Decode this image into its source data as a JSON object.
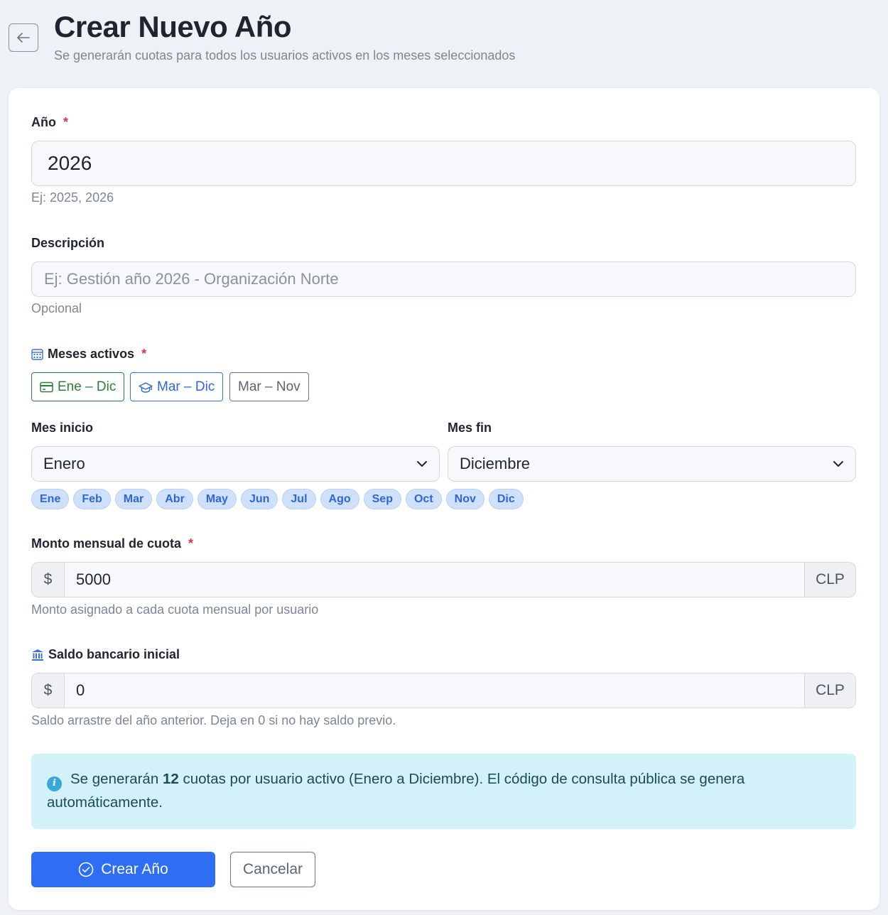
{
  "header": {
    "back_icon": "arrow-left-icon",
    "title": "Crear Nuevo Año",
    "subtitle": "Se generarán cuotas para todos los usuarios activos en los meses seleccionados"
  },
  "form": {
    "year": {
      "label": "Año",
      "required": "*",
      "value": "2026",
      "hint": "Ej: 2025, 2026"
    },
    "description": {
      "label": "Descripción",
      "placeholder": "Ej: Gestión año 2026 - Organización Norte",
      "value": "",
      "hint": "Opcional"
    },
    "months": {
      "label": "Meses activos",
      "required": "*",
      "icon": "calendar-icon",
      "presets": [
        {
          "label": "Ene – Dic",
          "icon": "credit-card-icon",
          "color": "#2e7d3e"
        },
        {
          "label": "Mar – Dic",
          "icon": "graduation-cap-icon",
          "color": "#2f66e0"
        },
        {
          "label": "Mar – Nov",
          "color": "#5b6470"
        }
      ],
      "start": {
        "label": "Mes inicio",
        "value": "Enero"
      },
      "end": {
        "label": "Mes fin",
        "value": "Diciembre"
      },
      "chips": [
        "Ene",
        "Feb",
        "Mar",
        "Abr",
        "May",
        "Jun",
        "Jul",
        "Ago",
        "Sep",
        "Oct",
        "Nov",
        "Dic"
      ]
    },
    "amount": {
      "label": "Monto mensual de cuota",
      "required": "*",
      "prefix": "$",
      "value": "5000",
      "suffix": "CLP",
      "hint": "Monto asignado a cada cuota mensual por usuario"
    },
    "balance": {
      "label": "Saldo bancario inicial",
      "icon": "bank-icon",
      "prefix": "$",
      "value": "0",
      "suffix": "CLP",
      "hint": "Saldo arrastre del año anterior. Deja en 0 si no hay saldo previo."
    }
  },
  "alert": {
    "icon": "info-icon",
    "text_before": "Se generarán ",
    "count": "12",
    "text_after": " cuotas por usuario activo (Enero a Diciembre). El código de consulta pública se genera automáticamente."
  },
  "actions": {
    "submit": "Crear Año",
    "submit_icon": "check-circle-icon",
    "cancel": "Cancelar"
  },
  "colors": {
    "primary": "#2d6ef5",
    "background": "#eef1f6",
    "alert_bg": "#d3f1f9",
    "required": "#dc3545"
  }
}
